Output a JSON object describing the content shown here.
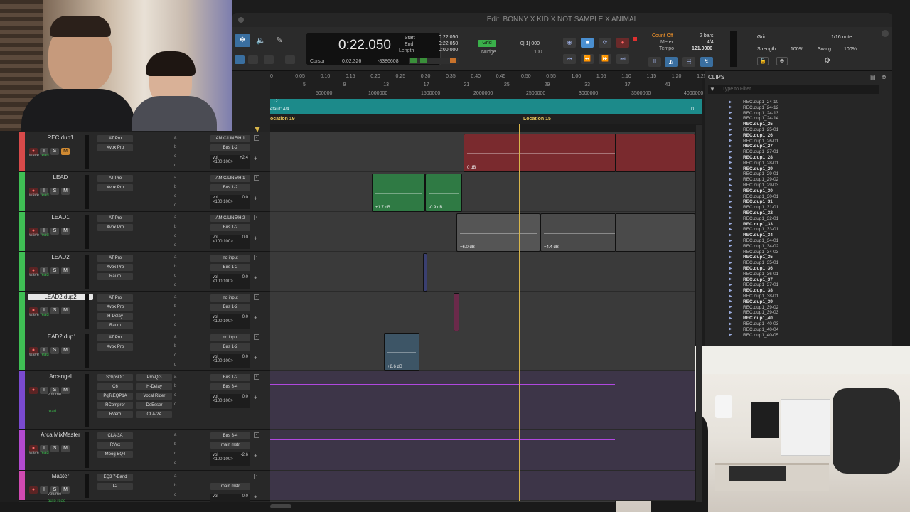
{
  "window": {
    "title": "Edit: BONNY X KID X NOT SAMPLE X ANIMAL"
  },
  "counters": {
    "main": "0:22.050",
    "start_label": "Start",
    "start": "0:22.050",
    "end_label": "End",
    "end": "0:22.050",
    "length_label": "Length",
    "length": "0:00.000",
    "cursor_label": "Cursor",
    "cursor": "0:02.326",
    "samples": "-8386608"
  },
  "grid_nudge": {
    "grid_label": "Grid",
    "grid_value": "0| 1| 000",
    "nudge_label": "Nudge",
    "nudge_value": "100"
  },
  "tempo": {
    "count_off": "Count Off",
    "meter_label": "Meter",
    "tempo_label": "Tempo",
    "bars": "2 bars",
    "meter": "4/4",
    "tempo": "121.0000"
  },
  "grid_panel": {
    "grid_label": "Grid:",
    "grid_value": "1/16 note",
    "strength_label": "Strength:",
    "strength": "100%",
    "swing_label": "Swing:",
    "swing": "100%"
  },
  "ruler": {
    "minsecs": [
      "0",
      "0:05",
      "0:10",
      "0:15",
      "0:20",
      "0:25",
      "0:30",
      "0:35",
      "0:40",
      "0:45",
      "0:50",
      "0:55",
      "1:00",
      "1:05",
      "1:10",
      "1:15",
      "1:20",
      "1:25"
    ],
    "bars": [
      "5",
      "9",
      "13",
      "17",
      "21",
      "25",
      "29",
      "33",
      "37",
      "41"
    ],
    "samples": [
      "500000",
      "1000000",
      "1500000",
      "2000000",
      "2500000",
      "3000000",
      "3500000",
      "4000000"
    ],
    "tempo_label": "121",
    "meter_label": "efault: 4/4",
    "marker_end": "D",
    "location_left": "ocation 19",
    "location_right": "Location 15"
  },
  "tracks": [
    {
      "name": "REC.dup1",
      "color": "#d84a4a",
      "mute_lit": true,
      "inserts": [
        "AT Pro",
        "Xvox Pro"
      ],
      "inserts_right": [],
      "input": "AMIC/LINE/HI1",
      "output": "Bus 1-2",
      "vol": "+2.4",
      "pan": "<100  100>"
    },
    {
      "name": "LEAD",
      "color": "#3fbf54",
      "mute_lit": false,
      "inserts": [
        "AT Pro",
        "Xvox Pro"
      ],
      "inserts_right": [],
      "input": "AMIC/LINE/HI1",
      "output": "Bus 1-2",
      "vol": "0.0",
      "pan": "<100  100>"
    },
    {
      "name": "LEAD1",
      "color": "#3fbf54",
      "mute_lit": false,
      "inserts": [
        "AT Pro",
        "Xvox Pro"
      ],
      "inserts_right": [],
      "input": "AMIC/LINE/HI2",
      "output": "Bus 1-2",
      "vol": "0.0",
      "pan": "<100  100>"
    },
    {
      "name": "LEAD2",
      "color": "#3fbf54",
      "mute_lit": false,
      "inserts": [
        "AT Pro",
        "Xvox Pro",
        "Raum"
      ],
      "inserts_right": [],
      "input": "no input",
      "output": "Bus 1-2",
      "vol": "0.0",
      "pan": "<100  100>"
    },
    {
      "name": "LEAD2.dup2",
      "color": "#3fbf54",
      "mute_lit": false,
      "selected": true,
      "inserts": [
        "AT Pro",
        "Xvox Pro",
        "H-Delay",
        "Raum"
      ],
      "inserts_right": [],
      "input": "no input",
      "output": "Bus 1-2",
      "vol": "0.0",
      "pan": "<100  100>"
    },
    {
      "name": "LEAD2.dup1",
      "color": "#3fbf54",
      "mute_lit": false,
      "inserts": [
        "AT Pro",
        "Xvox Pro"
      ],
      "inserts_right": [],
      "input": "no input",
      "output": "Bus 1-2",
      "vol": "0.0",
      "pan": "<100  100>"
    },
    {
      "name": "Arcangel",
      "color": "#7a4ad0",
      "mute_lit": false,
      "inserts": [
        "SchpsOC",
        "C6",
        "PqTcEQP1A",
        "RCompror",
        "RVerb"
      ],
      "inserts_right": [
        "Pro-Q 3",
        "H-Delay",
        "Vocal Rider",
        "DeEsser",
        "CLA-2A"
      ],
      "input": "Bus 1-2",
      "output": "Bus 3-4",
      "vol": "0.0",
      "pan": "<100  100>",
      "sub": "volume",
      "dyn": "dyn",
      "auto": "read"
    },
    {
      "name": "Arca MixMaster",
      "color": "#b24ad0",
      "mute_lit": false,
      "inserts": [
        "CLA-3A",
        "RVox",
        "Moog EQ4"
      ],
      "inserts_right": [],
      "input": "Bus 3-4",
      "output": "main mstr",
      "vol": "-2.6",
      "pan": "<100  100>"
    },
    {
      "name": "Master",
      "color": "#d04ab2",
      "mute_lit": false,
      "inserts": [
        "EQ3 7-Band",
        "L2"
      ],
      "inserts_right": [],
      "input": "",
      "output": "main mstr",
      "vol": "0.0",
      "pan": "",
      "sub": "volume",
      "auto": "auto read"
    }
  ],
  "track_common": {
    "rec_label": "",
    "input_label": "I",
    "solo_label": "S",
    "mute_label": "M",
    "wave_label": "wave",
    "read_label": "read"
  },
  "edit_clips": [
    {
      "track": 0,
      "gain": "0 dB"
    },
    {
      "track": 1,
      "gain": "+1.7 dB"
    },
    {
      "track": 1,
      "gain": "-0.9 dB"
    },
    {
      "track": 2,
      "gain": "+6.0 dB"
    },
    {
      "track": 2,
      "gain": "+4.4 dB"
    },
    {
      "track": 5,
      "gain": "+8.6 dB"
    }
  ],
  "clips_panel": {
    "title": "CLIPS",
    "filter_placeholder": "Type to Filter",
    "items": [
      {
        "name": "REC.dup1_24-10",
        "bold": false
      },
      {
        "name": "REC.dup1_24-12",
        "bold": false
      },
      {
        "name": "REC.dup1_24-13",
        "bold": false
      },
      {
        "name": "REC.dup1_24-14",
        "bold": false
      },
      {
        "name": "REC.dup1_25",
        "bold": true
      },
      {
        "name": "REC.dup1_25-01",
        "bold": false
      },
      {
        "name": "REC.dup1_26",
        "bold": true
      },
      {
        "name": "REC.dup1_26-01",
        "bold": false
      },
      {
        "name": "REC.dup1_27",
        "bold": true
      },
      {
        "name": "REC.dup1_27-01",
        "bold": false
      },
      {
        "name": "REC.dup1_28",
        "bold": true
      },
      {
        "name": "REC.dup1_28-01",
        "bold": false
      },
      {
        "name": "REC.dup1_29",
        "bold": true
      },
      {
        "name": "REC.dup1_29-01",
        "bold": false
      },
      {
        "name": "REC.dup1_29-02",
        "bold": false
      },
      {
        "name": "REC.dup1_29-03",
        "bold": false
      },
      {
        "name": "REC.dup1_30",
        "bold": true
      },
      {
        "name": "REC.dup1_30-01",
        "bold": false
      },
      {
        "name": "REC.dup1_31",
        "bold": true
      },
      {
        "name": "REC.dup1_31-01",
        "bold": false
      },
      {
        "name": "REC.dup1_32",
        "bold": true
      },
      {
        "name": "REC.dup1_32-01",
        "bold": false
      },
      {
        "name": "REC.dup1_33",
        "bold": true
      },
      {
        "name": "REC.dup1_33-01",
        "bold": false
      },
      {
        "name": "REC.dup1_34",
        "bold": true
      },
      {
        "name": "REC.dup1_34-01",
        "bold": false
      },
      {
        "name": "REC.dup1_34-02",
        "bold": false
      },
      {
        "name": "REC.dup1_34-03",
        "bold": false
      },
      {
        "name": "REC.dup1_35",
        "bold": true
      },
      {
        "name": "REC.dup1_35-01",
        "bold": false
      },
      {
        "name": "REC.dup1_36",
        "bold": true
      },
      {
        "name": "REC.dup1_36-01",
        "bold": false
      },
      {
        "name": "REC.dup1_37",
        "bold": true
      },
      {
        "name": "REC.dup1_37-01",
        "bold": false
      },
      {
        "name": "REC.dup1_38",
        "bold": true
      },
      {
        "name": "REC.dup1_38-01",
        "bold": false
      },
      {
        "name": "REC.dup1_39",
        "bold": true
      },
      {
        "name": "REC.dup1_39-02",
        "bold": false
      },
      {
        "name": "REC.dup1_39-03",
        "bold": false
      },
      {
        "name": "REC.dup1_40",
        "bold": true
      },
      {
        "name": "REC.dup1_40-03",
        "bold": false
      },
      {
        "name": "REC.dup1_40-04",
        "bold": false
      },
      {
        "name": "REC.dup1_40-05",
        "bold": false
      }
    ]
  },
  "colors": {
    "accent_green": "#7fe07a",
    "tempo_ruler": "#1c8a8a",
    "playhead": "#d8b64a",
    "rec_clip": "#7a2a2e",
    "lead_clip": "#2f7a44"
  }
}
